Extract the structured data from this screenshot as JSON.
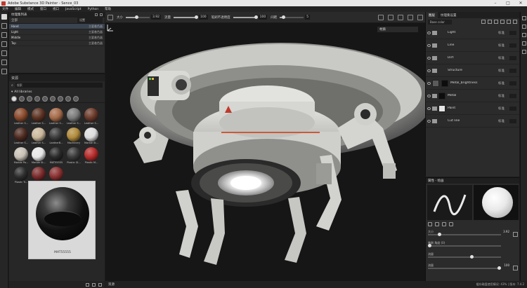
{
  "window": {
    "title": "Adobe Substance 3D Painter - Sence_03"
  },
  "menu": [
    "文件",
    "编辑",
    "模式",
    "窗口",
    "视口",
    "JavaScript",
    "Python",
    "帮助"
  ],
  "toolbar": {
    "size_label": "大小",
    "size_value": "3.92",
    "flow_label": "流量",
    "flow_value": "100",
    "stroke_opacity_label": "笔刷不透明度",
    "stroke_opacity_value": "100",
    "spacing_label": "间距",
    "spacing_value": "5"
  },
  "texture_sets": {
    "title": "纹理集列表",
    "settings_label": "设置",
    "filter_label": "全部",
    "filter_value": "设置",
    "items": [
      {
        "name": "Hand",
        "status": "主要着色器"
      },
      {
        "name": "Light",
        "status": "主要着色器"
      },
      {
        "name": "Middle",
        "status": "主要着色器"
      },
      {
        "name": "Top",
        "status": "主要着色器"
      }
    ]
  },
  "shelf": {
    "title": "资源",
    "search_placeholder": "搜索",
    "path": "All libraries",
    "materials": [
      {
        "label": "Leather S...",
        "color": "#8a4a2c"
      },
      {
        "label": "Leather S...",
        "color": "#5c3222"
      },
      {
        "label": "Leather S...",
        "color": "#a56a48"
      },
      {
        "label": "Leather S...",
        "color": "#7a7a7a"
      },
      {
        "label": "Leather S...",
        "color": "#6b3a2a"
      },
      {
        "label": "Leather S...",
        "color": "#4d2a20"
      },
      {
        "label": "Leather S...",
        "color": "#c9b79a"
      },
      {
        "label": "LeatherB...",
        "color": "#3c3c3c"
      },
      {
        "label": "Machinery",
        "color": "#b08a3a"
      },
      {
        "label": "Marble St...",
        "color": "#dcdcdc"
      },
      {
        "label": "Marble Pa...",
        "color": "#c8c0b4"
      },
      {
        "label": "Marble St...",
        "color": "#e6e6e6"
      },
      {
        "label": "MAT55555",
        "color": "#2a2a2a"
      },
      {
        "label": "Plastic Gl...",
        "color": "#3a3a3a"
      },
      {
        "label": "Plastic M...",
        "color": "#b52a2a"
      },
      {
        "label": "Plastic Tr...",
        "color": "#2e2e2e"
      },
      {
        "label": "Plastic Tr...",
        "color": "#7a2a2a"
      },
      {
        "label": "Plastic Ur...",
        "color": "#8a3030"
      }
    ],
    "preview_label": "MAT55555"
  },
  "viewport": {
    "mode": "材质"
  },
  "status": {
    "label": "资源",
    "right": "缓存磁盘使用情况: 43% | 版本: 7.4.2"
  },
  "layers": {
    "tabs": [
      "图层",
      "纹理集设置"
    ],
    "channel": "Base color",
    "items": [
      {
        "name": "Light",
        "blend": "标准",
        "kind": "folder",
        "mask": ""
      },
      {
        "name": "Line",
        "blend": "标准",
        "kind": "folder",
        "mask": ""
      },
      {
        "name": "Dirt",
        "blend": "标准",
        "kind": "folder",
        "mask": ""
      },
      {
        "name": "Structure",
        "blend": "标准",
        "kind": "folder",
        "mask": ""
      },
      {
        "name": "Metal_brightness",
        "blend": "标准",
        "kind": "layer",
        "mask": "dark"
      },
      {
        "name": "Metal",
        "blend": "标准",
        "kind": "folder",
        "mask": "dark"
      },
      {
        "name": "Paint",
        "blend": "标准",
        "kind": "folder",
        "mask": "white"
      },
      {
        "name": "Cut line",
        "blend": "标准",
        "kind": "folder",
        "mask": ""
      }
    ]
  },
  "properties": {
    "title": "属性 - 绘画",
    "size_label": "大小",
    "size_value": "3.92",
    "flow_label": "流量",
    "flow_value": "100",
    "angle_label": "笔刷 角度 (0)",
    "opacity_label": "流量",
    "opacity_value": "100"
  }
}
